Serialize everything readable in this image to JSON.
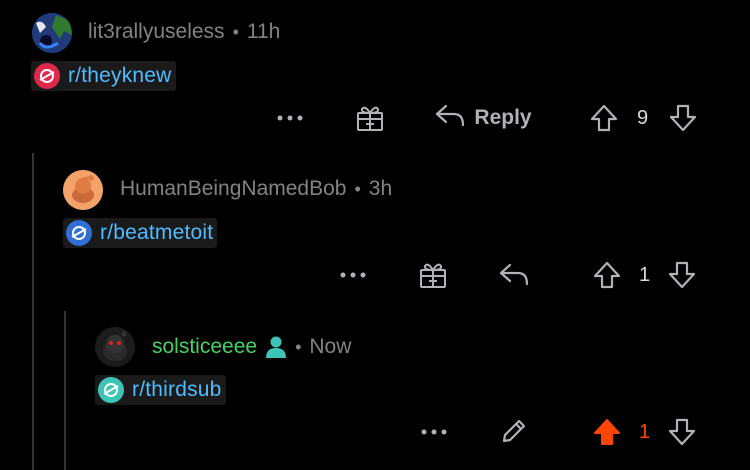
{
  "comments": [
    {
      "username": "lit3rallyuseless",
      "separator": "•",
      "time": "11h",
      "subreddit": "r/theyknew",
      "reply_label": "Reply",
      "vote_count": "9"
    },
    {
      "username": "HumanBeingNamedBob",
      "separator": "•",
      "time": "3h",
      "subreddit": "r/beatmetoit",
      "vote_count": "1"
    },
    {
      "username": "solsticeeee",
      "separator": "•",
      "time": "Now",
      "subreddit": "r/thirdsub",
      "vote_count": "1"
    }
  ],
  "colors": {
    "background": "#000000",
    "link": "#4fbcff",
    "meta": "#818384",
    "icon": "#b0b3b5",
    "upvoted": "#ff4500",
    "mod_user": "#46d160"
  },
  "icons": [
    "more-icon",
    "gift-icon",
    "reply-icon",
    "upvote-icon",
    "downvote-icon",
    "edit-icon",
    "user-badge-icon"
  ]
}
